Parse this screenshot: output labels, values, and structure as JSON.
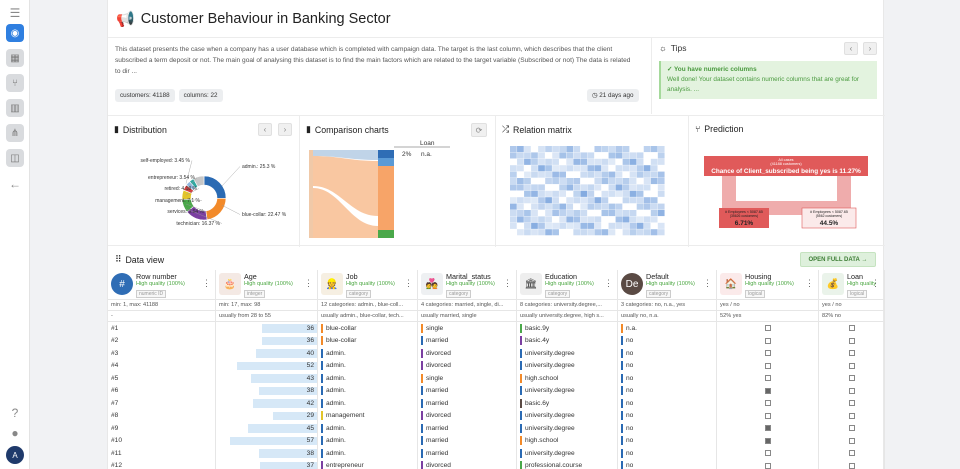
{
  "header": {
    "title": "Customer Behaviour in Banking Sector"
  },
  "description": "This dataset presents the case when a company has a user database which is completed with campaign data. The target is the last column, which describes that the client subscribed a term deposit or not. The main goal of analysing this dataset is to find the main factors which are related to the target variable (Subscribed or not) The data is related to dir ...",
  "chips": {
    "customers": "customers: 41188",
    "columns": "columns: 22",
    "age": "21 days ago"
  },
  "tips": {
    "title": "Tips",
    "heading": "✓ You have numeric columns",
    "text": "Well done! Your dataset contains numeric columns that are great for analysis. ..."
  },
  "panels": {
    "distribution": "Distribution",
    "comparison": "Comparison charts",
    "relation": "Relation matrix",
    "prediction": "Prediction"
  },
  "distribution": {
    "labels": [
      "self-employed: 3.45 %",
      "entrepreneur: 3.54 %",
      "retired: 4.18 %",
      "management: 7.1 %",
      "services: 9.64 %",
      "technician: 16.37 %",
      "admin.: 25.3 %",
      "blue-collar: 22.47 %"
    ],
    "slices": [
      {
        "name": "admin.",
        "value": 25.3,
        "color": "#2a6ab3"
      },
      {
        "name": "blue-collar",
        "value": 22.47,
        "color": "#f28a2a"
      },
      {
        "name": "technician",
        "value": 16.37,
        "color": "#7b3fa1"
      },
      {
        "name": "services",
        "value": 9.64,
        "color": "#4aa84a"
      },
      {
        "name": "management",
        "value": 7.1,
        "color": "#e2c42a"
      },
      {
        "name": "retired",
        "value": 4.18,
        "color": "#d43f3f"
      },
      {
        "name": "entrepreneur",
        "value": 3.54,
        "color": "#8fb8e0"
      },
      {
        "name": "self-employed",
        "value": 3.45,
        "color": "#2fa8a0"
      },
      {
        "name": "other",
        "value": 7.95,
        "color": "#c7c7c7"
      }
    ]
  },
  "comparison": {
    "legend_title": "Loan",
    "legend_pct": "2%",
    "legend_val": "n.a."
  },
  "prediction": {
    "root_line1": "All cases",
    "root_line2": "(41188 customers)",
    "root_main": "Chance of Client_subscribed being yes is 11.27%",
    "left_cond": "# Employees < 5087.65",
    "left_sub": "(35626 customers)",
    "left_pct": "6.71%",
    "right_cond": "# Employees < 5087.65",
    "right_sub": "(5562 customers)",
    "right_pct": "44.5%"
  },
  "dataview": {
    "title": "Data view",
    "open_button": "OPEN FULL DATA"
  },
  "columns": [
    {
      "name": "Row number",
      "quality": "High quality (100%)",
      "type": "numeric ID",
      "stat1": "min: 1, max: 41188",
      "stat2": "-",
      "icon": "#",
      "icon_color": "#2f6db5"
    },
    {
      "name": "Age",
      "quality": "High quality (100%)",
      "type": "integer",
      "stat1": "min: 17, max: 98",
      "stat2": "usually from 28 to 55",
      "icon": "🎂",
      "icon_color": "#f4e9e4"
    },
    {
      "name": "Job",
      "quality": "High quality (100%)",
      "type": "category",
      "stat1": "12 categories: admin., blue-coll...",
      "stat2": "usually admin., blue-collar, tech...",
      "icon": "👷",
      "icon_color": "#f6efe2"
    },
    {
      "name": "Marital_status",
      "quality": "High quality (100%)",
      "type": "category",
      "stat1": "4 categories: married, single, di...",
      "stat2": "usually married, single",
      "icon": "💑",
      "icon_color": "#eef0f2"
    },
    {
      "name": "Education",
      "quality": "High quality (100%)",
      "type": "category",
      "stat1": "8 categories: university.degree,...",
      "stat2": "usually university.degree, high s...",
      "icon": "🏛",
      "icon_color": "#eeeeee"
    },
    {
      "name": "Default",
      "quality": "High quality (100%)",
      "type": "category",
      "stat1": "3 categories: no, n.a., yes",
      "stat2": "usually no, n.a.",
      "icon": "De",
      "icon_color": "#5a4a44"
    },
    {
      "name": "Housing",
      "quality": "High quality (100%)",
      "type": "logical",
      "stat1": "yes / no",
      "stat2": "52% yes",
      "icon": "🏠",
      "icon_color": "#fbeaea"
    },
    {
      "name": "Loan",
      "quality": "High quality",
      "type": "logical",
      "stat1": "yes / no",
      "stat2": "82% no",
      "icon": "💰",
      "icon_color": "#eaf3ea"
    }
  ],
  "rows": [
    {
      "n": "#1",
      "age": 36,
      "job": "blue-collar",
      "marital": "single",
      "edu": "basic.9y",
      "def": "n.a.",
      "housing": false,
      "loan": false
    },
    {
      "n": "#2",
      "age": 36,
      "job": "blue-collar",
      "marital": "married",
      "edu": "basic.4y",
      "def": "no",
      "housing": false,
      "loan": false
    },
    {
      "n": "#3",
      "age": 40,
      "job": "admin.",
      "marital": "divorced",
      "edu": "university.degree",
      "def": "no",
      "housing": false,
      "loan": false
    },
    {
      "n": "#4",
      "age": 52,
      "job": "admin.",
      "marital": "divorced",
      "edu": "university.degree",
      "def": "no",
      "housing": false,
      "loan": false
    },
    {
      "n": "#5",
      "age": 43,
      "job": "admin.",
      "marital": "single",
      "edu": "high.school",
      "def": "no",
      "housing": false,
      "loan": false
    },
    {
      "n": "#6",
      "age": 38,
      "job": "admin.",
      "marital": "married",
      "edu": "university.degree",
      "def": "no",
      "housing": true,
      "loan": false
    },
    {
      "n": "#7",
      "age": 42,
      "job": "admin.",
      "marital": "married",
      "edu": "basic.6y",
      "def": "no",
      "housing": false,
      "loan": false
    },
    {
      "n": "#8",
      "age": 29,
      "job": "management",
      "marital": "divorced",
      "edu": "university.degree",
      "def": "no",
      "housing": false,
      "loan": false
    },
    {
      "n": "#9",
      "age": 45,
      "job": "admin.",
      "marital": "married",
      "edu": "university.degree",
      "def": "no",
      "housing": true,
      "loan": false
    },
    {
      "n": "#10",
      "age": 57,
      "job": "admin.",
      "marital": "married",
      "edu": "high.school",
      "def": "no",
      "housing": true,
      "loan": false
    },
    {
      "n": "#11",
      "age": 38,
      "job": "admin.",
      "marital": "married",
      "edu": "university.degree",
      "def": "no",
      "housing": false,
      "loan": false
    },
    {
      "n": "#12",
      "age": 37,
      "job": "entrepreneur",
      "marital": "divorced",
      "edu": "professional.course",
      "def": "no",
      "housing": false,
      "loan": false
    }
  ],
  "colors": {
    "job": {
      "blue-collar": "#f28a2a",
      "admin.": "#2a6ab3",
      "management": "#e2c42a",
      "entrepreneur": "#7b3fa1"
    },
    "marital": {
      "single": "#f28a2a",
      "married": "#2a6ab3",
      "divorced": "#7b3fa1"
    },
    "edu": {
      "basic.9y": "#4aa84a",
      "basic.4y": "#7b3fa1",
      "university.degree": "#2a6ab3",
      "high.school": "#f28a2a",
      "basic.6y": "#5a4a44",
      "professional.course": "#4aa84a"
    },
    "def": {
      "n.a.": "#f28a2a",
      "no": "#2a6ab3"
    }
  }
}
